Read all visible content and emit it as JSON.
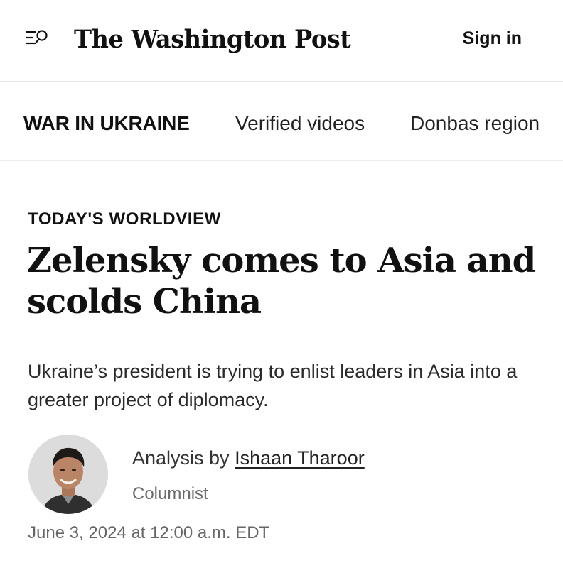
{
  "header": {
    "menu_icon": "menu-search-icon",
    "logo_text": "The Washington Post",
    "signin_label": "Sign in"
  },
  "subnav": {
    "section": "WAR IN UKRAINE",
    "items": [
      "Verified videos",
      "Donbas region"
    ]
  },
  "article": {
    "kicker": "TODAY'S WORLDVIEW",
    "headline": "Zelensky comes to Asia and scolds China",
    "dek": "Ukraine’s president is trying to enlist leaders in Asia into a greater project of diplomacy.",
    "byline_prefix": "Analysis by",
    "author": "Ishaan Tharoor",
    "author_role": "Columnist",
    "timestamp": "June 3, 2024 at 12:00 a.m. EDT"
  },
  "colors": {
    "text": "#111111",
    "muted": "#6b6b6b",
    "divider": "#e3e3e3"
  }
}
